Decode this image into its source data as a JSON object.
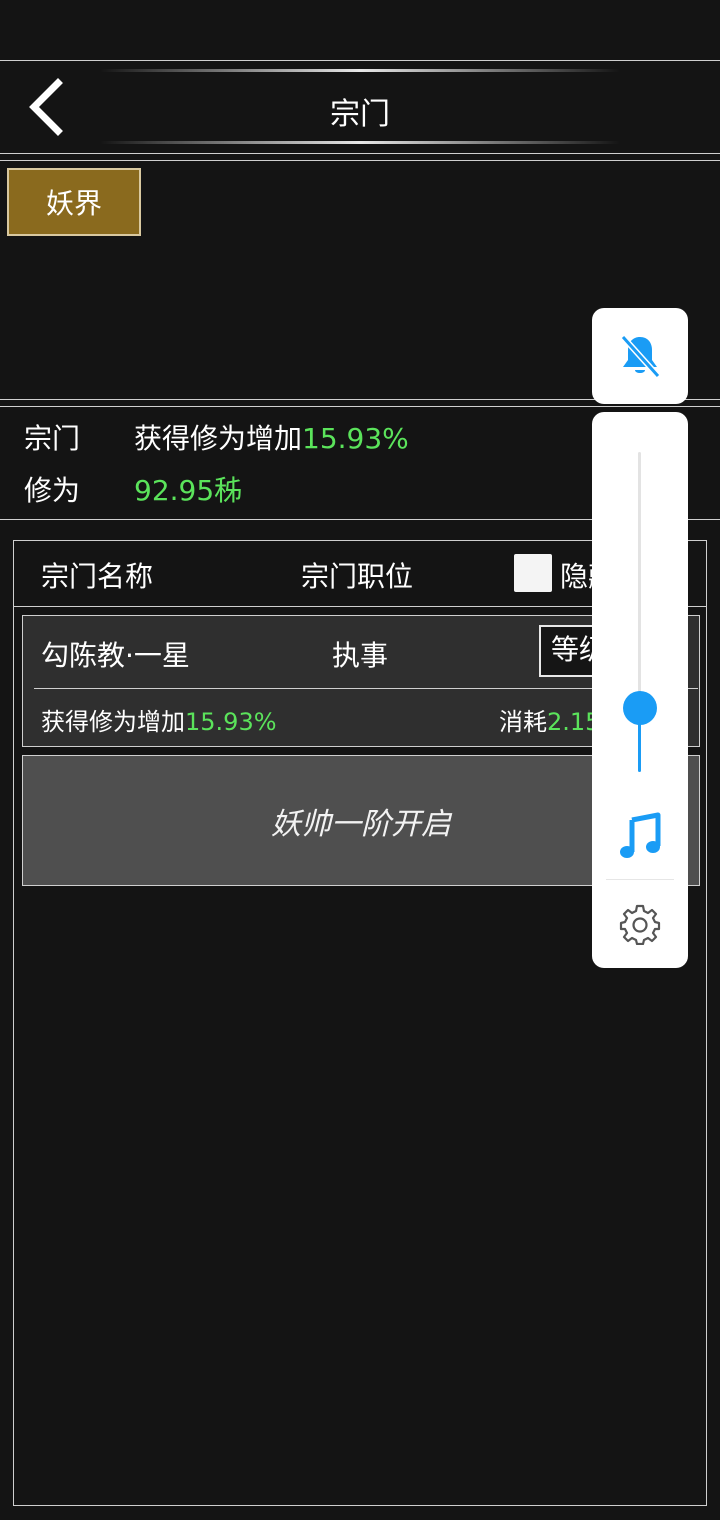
{
  "header": {
    "title": "宗门"
  },
  "realm_tabs": [
    {
      "label": "妖界",
      "active": true
    }
  ],
  "stats": {
    "sect_label": "宗门",
    "sect_bonus_prefix": "获得修为增加",
    "sect_bonus_value": "15.93%",
    "cultivation_label": "修为",
    "cultivation_value": "92.95秭"
  },
  "list": {
    "columns": {
      "name": "宗门名称",
      "position": "宗门职位",
      "hide": "隐藏"
    },
    "hide_checked": false,
    "sects": [
      {
        "name": "勾陈教·一星",
        "role": "执事",
        "level_button": "等级",
        "bonus_prefix": "获得修为增加",
        "bonus_value": "15.93%",
        "cost_prefix": "消耗",
        "cost_value": "2.15"
      }
    ],
    "locked_message": "妖帅一阶开启"
  },
  "overlay": {
    "volume_level": 0.2,
    "icons": {
      "mute": "bell-off-icon",
      "music": "music-note-icon",
      "settings": "gear-icon"
    },
    "accent_color": "#1a9cf5"
  },
  "colors": {
    "highlight_green": "#5be35b",
    "tab_gold": "#8a6a1e"
  }
}
